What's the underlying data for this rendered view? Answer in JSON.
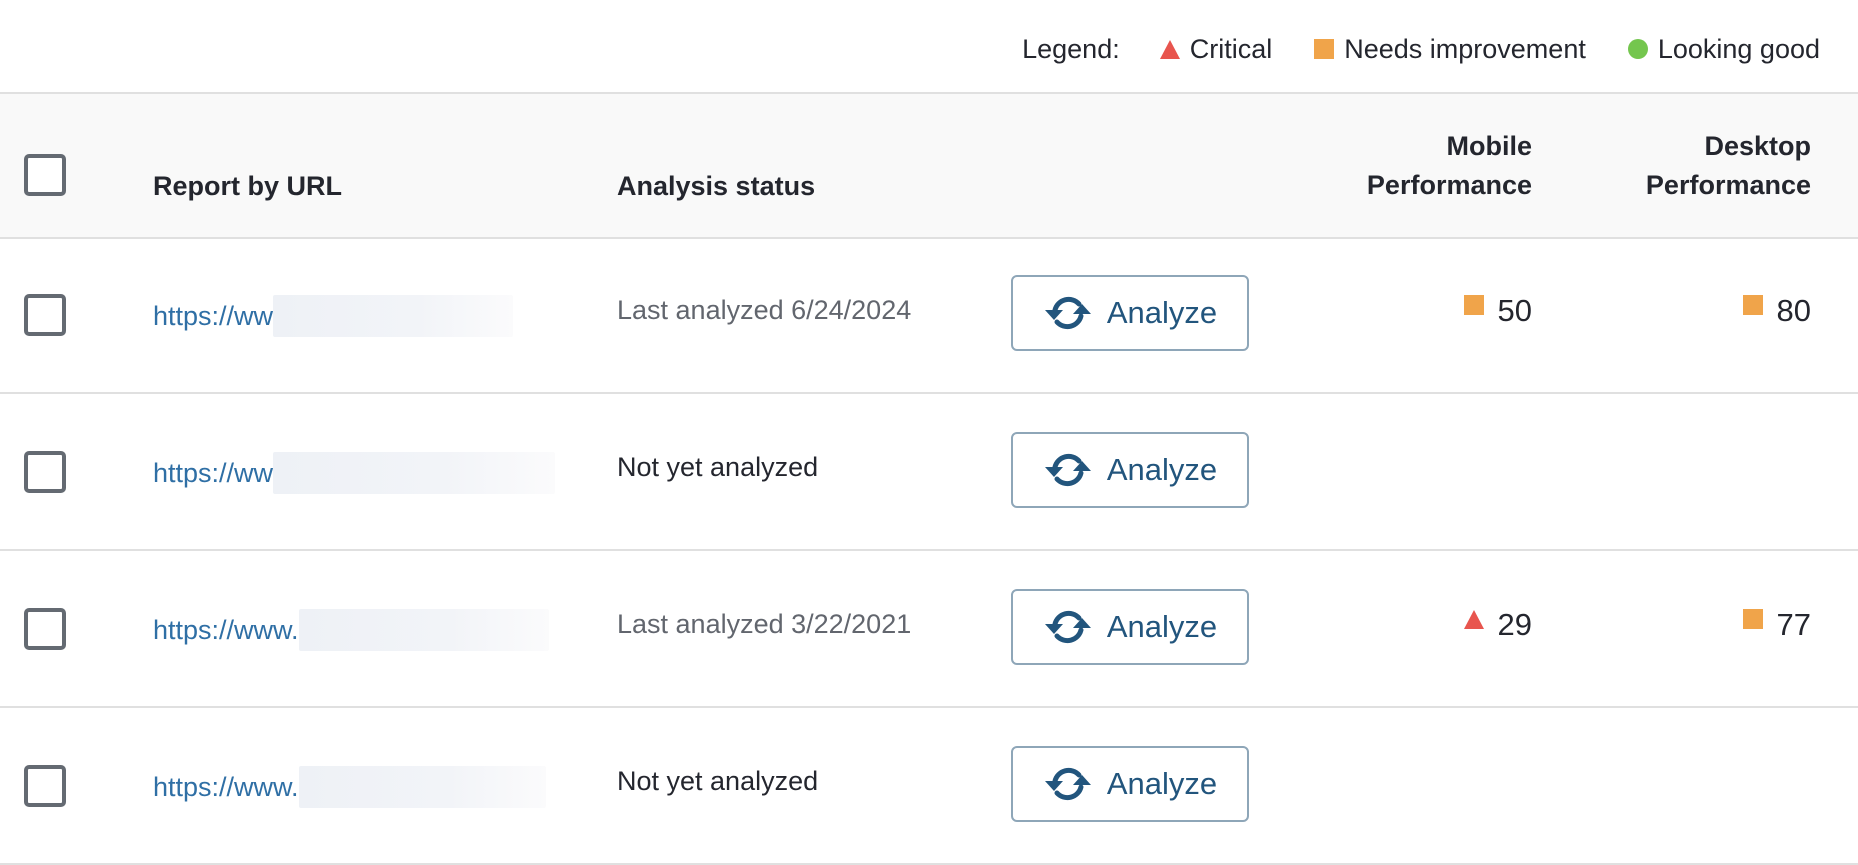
{
  "legend": {
    "label": "Legend:",
    "items": [
      {
        "icon": "triangle-icon",
        "label": "Critical",
        "color": "#e8554e"
      },
      {
        "icon": "square-icon",
        "label": "Needs improvement",
        "color": "#f0a44a"
      },
      {
        "icon": "circle-icon",
        "label": "Looking good",
        "color": "#74c64e"
      }
    ]
  },
  "table": {
    "headers": {
      "url": "Report by URL",
      "status": "Analysis status",
      "mobile_line1": "Mobile",
      "mobile_line2": "Performance",
      "desktop_line1": "Desktop",
      "desktop_line2": "Performance"
    },
    "analyze_label": "Analyze",
    "rows": [
      {
        "url": "https://ww",
        "status": "Last analyzed 6/24/2024",
        "mobile": {
          "value": "50",
          "rating": "needs-improvement"
        },
        "desktop": {
          "value": "80",
          "rating": "needs-improvement"
        }
      },
      {
        "url": "https://ww",
        "status": "Not yet analyzed",
        "mobile": null,
        "desktop": null
      },
      {
        "url": "https://www.",
        "status": "Last analyzed 3/22/2021",
        "mobile": {
          "value": "29",
          "rating": "critical"
        },
        "desktop": {
          "value": "77",
          "rating": "needs-improvement"
        }
      },
      {
        "url": "https://www.",
        "status": "Not yet analyzed",
        "mobile": null,
        "desktop": null
      }
    ]
  },
  "colors": {
    "link": "#2f6fa5",
    "button_text": "#22557d",
    "critical": "#e8554e",
    "needs_improvement": "#f0a44a",
    "looking_good": "#74c64e"
  }
}
